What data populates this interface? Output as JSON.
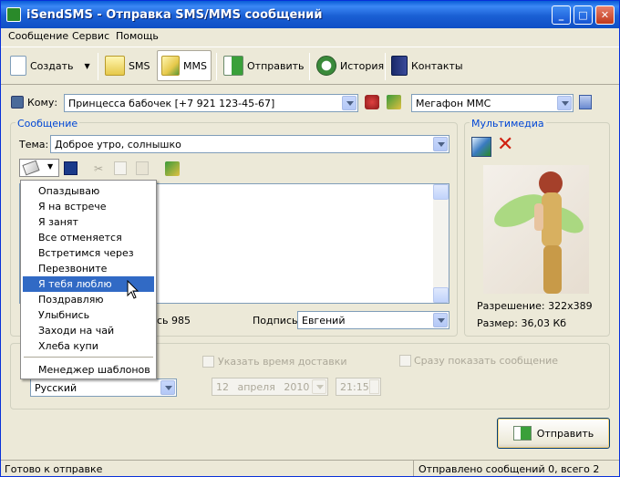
{
  "window": {
    "title": "iSendSMS - Отправка SMS/MMS сообщений"
  },
  "menubar": [
    "Сообщение",
    "Сервис",
    "Помощь"
  ],
  "toolbar": {
    "create": "Создать",
    "sms": "SMS",
    "mms": "MMS",
    "send": "Отправить",
    "history": "История",
    "contacts": "Контакты"
  },
  "recipient": {
    "label": "Кому:",
    "value": "Принцесса бабочек [+7 921 123-45-67]",
    "operator": "Мегафон MMC"
  },
  "message": {
    "group_title": "Сообщение",
    "subject_label": "Тема:",
    "subject_value": "Доброе утро, солнышко",
    "chars_left": "сь 985",
    "signature_label": "Подпись",
    "signature_value": "Евгений"
  },
  "template_menu": {
    "items": [
      "Опаздываю",
      "Я на встрече",
      "Я занят",
      "Все отменяется",
      "Встретимся через",
      "Перезвоните",
      "Я тебя люблю",
      "Поздравляю",
      "Улыбнись",
      "Заходи на чай",
      "Хлеба купи"
    ],
    "highlighted": "Я тебя люблю",
    "manager": "Менеджер шаблонов"
  },
  "multimedia": {
    "group_title": "Мультимедиа",
    "resolution": "Разрешение: 322x389",
    "size": "Размер: 36,03 Кб"
  },
  "options": {
    "language": "Русский",
    "delivery_time_label": "Указать время доставки",
    "show_now_label": "Сразу показать сообщение",
    "date_day": "12",
    "date_month": "апреля",
    "date_year": "2010",
    "time": "21:15"
  },
  "send_button": "Отправить",
  "status": {
    "left": "Готово к отправке",
    "right": "Отправлено сообщений 0, всего 2"
  },
  "colors": {
    "title_bar": "#0a5cd6",
    "highlight": "#316ac5",
    "group_label": "#0046d5",
    "window_bg": "#ece9d8"
  }
}
